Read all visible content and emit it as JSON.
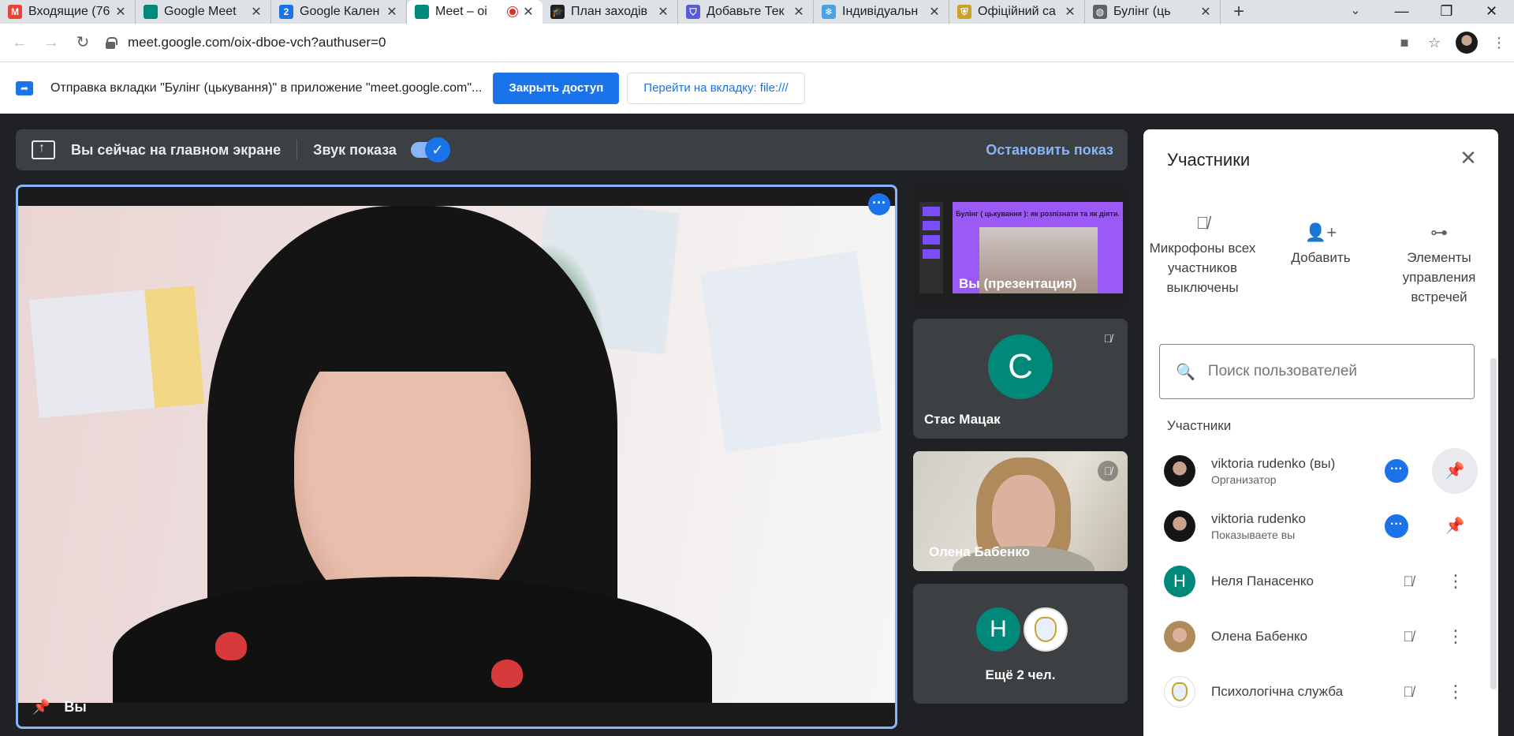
{
  "browser": {
    "tabs": [
      {
        "title": "Входящие (76",
        "icon": "gmail-icon",
        "color": "#ea4335",
        "glyph": "M"
      },
      {
        "title": "Google Meet",
        "icon": "meet-icon",
        "color": "#00897b",
        "glyph": ""
      },
      {
        "title": "Google Кален",
        "icon": "calendar-icon",
        "color": "#1a73e8",
        "glyph": "2"
      },
      {
        "title": "Meet – oi",
        "icon": "meet-icon",
        "color": "#00897b",
        "glyph": "",
        "active": true
      },
      {
        "title": "План заходів",
        "icon": "graduation-cap-icon",
        "color": "#202124",
        "glyph": "🎓"
      },
      {
        "title": "Добавьте Тек",
        "icon": "shield-icon",
        "color": "#5b5bd6",
        "glyph": "⛉"
      },
      {
        "title": "Індивідуальн",
        "icon": "snowflake-icon",
        "color": "#4aa3df",
        "glyph": "❄"
      },
      {
        "title": "Офіційний са",
        "icon": "emblem-icon",
        "color": "#c9a227",
        "glyph": "⛨"
      },
      {
        "title": "Булінг (ць",
        "icon": "globe-icon",
        "color": "#5f6368",
        "glyph": "◍"
      }
    ],
    "new_tab": "+",
    "url": "meet.google.com/oix-dboe-vch?authuser=0"
  },
  "infobar": {
    "text": "Отправка вкладки \"Булінг (цькування)\" в приложение \"meet.google.com\"...",
    "stop_button": "Закрыть доступ",
    "switch_button": "Перейти на вкладку: file:///"
  },
  "presenting": {
    "status": "Вы сейчас на главном экране",
    "sound_label": "Звук показа",
    "sound_on": true,
    "stop": "Остановить показ"
  },
  "main_tile": {
    "name": "Вы"
  },
  "tiles": [
    {
      "name": "Вы (презентация)",
      "slide_title": "Булінг ( цькування ): як розпізнати та як діяти."
    },
    {
      "name": "Стас Мацак",
      "initial": "С"
    },
    {
      "name": "Олена Бабенко"
    },
    {
      "name": "Ещё 2 чел.",
      "initial": "Н"
    }
  ],
  "panel": {
    "title": "Участники",
    "actions": [
      {
        "label": "Микрофоны всех участников выключены",
        "icon": "mic-off-icon"
      },
      {
        "label": "Добавить",
        "icon": "add-person-icon"
      },
      {
        "label": "Элементы управления встречей",
        "icon": "toggle-icon"
      }
    ],
    "search_placeholder": "Поиск пользователей",
    "section_label": "Участники",
    "participants": [
      {
        "name": "viktoria rudenko (вы)",
        "role": "Организатор"
      },
      {
        "name": "viktoria rudenko",
        "role": "Показываете вы"
      },
      {
        "name": "Неля Панасенко",
        "initial": "Н"
      },
      {
        "name": "Олена Бабенко"
      },
      {
        "name": "Психологічна служба"
      }
    ]
  }
}
